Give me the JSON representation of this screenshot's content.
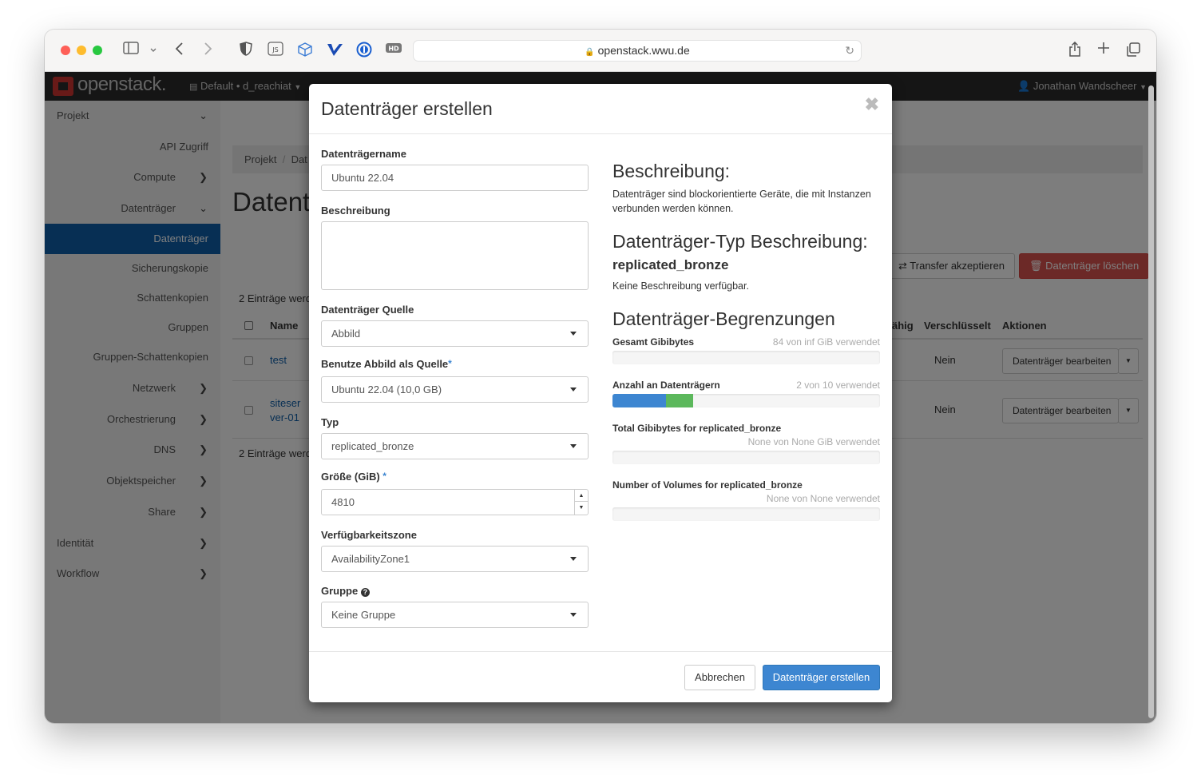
{
  "browser": {
    "url": "openstack.wwu.de",
    "toolbar_icons": [
      "sidebar-icon",
      "chevron-down-icon",
      "back-icon",
      "forward-icon",
      "shield-icon",
      "javascript-icon",
      "cube-icon",
      "vivaldi-icon",
      "password-icon",
      "hd-icon",
      "lock-icon",
      "reload-icon",
      "share-icon",
      "new-tab-icon",
      "tabs-icon"
    ],
    "js_badge": "JS",
    "hd_badge": "HD"
  },
  "topnav": {
    "logo": "openstack.",
    "project": "Default • d_reachiat",
    "user": "Jonathan Wandscheer"
  },
  "sidebar": {
    "items": [
      {
        "label": "Projekt"
      },
      {
        "label": "API Zugriff"
      },
      {
        "label": "Compute"
      },
      {
        "label": "Datenträger"
      },
      {
        "label": "Datenträger"
      },
      {
        "label": "Sicherungskopie"
      },
      {
        "label": "Schattenkopien"
      },
      {
        "label": "Gruppen"
      },
      {
        "label": "Gruppen-Schattenkopien"
      },
      {
        "label": "Netzwerk"
      },
      {
        "label": "Orchestrierung"
      },
      {
        "label": "DNS"
      },
      {
        "label": "Objektspeicher"
      },
      {
        "label": "Share"
      },
      {
        "label": "Identität"
      },
      {
        "label": "Workflow"
      }
    ]
  },
  "page": {
    "breadcrumb_1": "Projekt",
    "breadcrumb_2": "Dat",
    "title": "Datent",
    "count_top": "2 Einträge werd",
    "count_bottom": "2 Einträge werd",
    "transfer_button": "Transfer akzeptieren",
    "delete_button": "Datenträger löschen",
    "col_name": "Name",
    "col_bootable": "ähig",
    "col_encrypted": "Verschlüsselt",
    "col_actions": "Aktionen",
    "rows": [
      {
        "name": "test",
        "encrypted": "Nein",
        "action": "Datenträger bearbeiten"
      },
      {
        "name_1": "siteser",
        "name_2": "ver-01",
        "encrypted": "Nein",
        "action": "Datenträger bearbeiten"
      }
    ]
  },
  "modal": {
    "title": "Datenträger erstellen",
    "name_label": "Datenträgername",
    "name_value": "Ubuntu 22.04",
    "desc_label": "Beschreibung",
    "desc_value": "",
    "source_label": "Datenträger Quelle",
    "source_value": "Abbild",
    "image_label": "Benutze Abbild als Quelle",
    "image_value": "Ubuntu 22.04 (10,0 GB)",
    "type_label": "Typ",
    "type_value": "replicated_bronze",
    "size_label": "Größe (GiB)",
    "size_value": "4810",
    "zone_label": "Verfügbarkeitszone",
    "zone_value": "AvailabilityZone1",
    "group_label": "Gruppe",
    "group_value": "Keine Gruppe",
    "required_mark": "*",
    "help_glyph": "?",
    "cancel_button": "Abbrechen",
    "submit_button": "Datenträger erstellen",
    "right": {
      "desc_heading": "Beschreibung:",
      "desc_text": "Datenträger sind blockorientierte Geräte, die mit Instanzen verbunden werden können.",
      "type_heading": "Datenträger-Typ Beschreibung:",
      "type_name": "replicated_bronze",
      "type_text": "Keine Beschreibung verfügbar.",
      "limits_heading": "Datenträger-Begrenzungen",
      "quotas": [
        {
          "label": "Gesamt Gibibytes",
          "used_text": "84 von inf GiB verwendet",
          "used_fraction": 0,
          "added_fraction": 0
        },
        {
          "label": "Anzahl an Datenträgern",
          "used_text": "2 von 10 verwendet",
          "used_fraction": 0.2,
          "added_fraction": 0.1
        },
        {
          "label": "Total Gibibytes for replicated_bronze",
          "used_text": "None von None GiB verwendet",
          "used_fraction": 0,
          "added_fraction": 0
        },
        {
          "label": "Number of Volumes for replicated_bronze",
          "used_text": "None von None verwendet",
          "used_fraction": 0,
          "added_fraction": 0
        }
      ]
    }
  },
  "colors": {
    "primary": "#3d86d1",
    "quota_used": "#3d86d1",
    "quota_added": "#5cb85c",
    "danger": "#d9534f",
    "sidebar_active": "#0f5ea8"
  }
}
